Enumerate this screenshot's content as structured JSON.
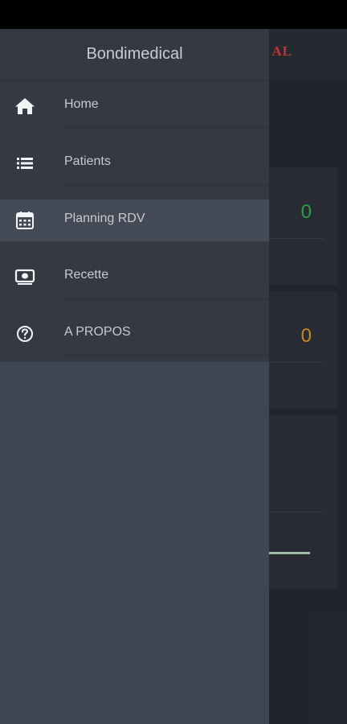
{
  "app": {
    "title_fragment": "AL",
    "stats": [
      {
        "value": "0",
        "color": "#2fb355"
      },
      {
        "value": "0",
        "color": "#e39b1f"
      }
    ]
  },
  "drawer": {
    "title": "Bondimedical",
    "items": [
      {
        "label": "Home",
        "icon": "home-icon"
      },
      {
        "label": "Patients",
        "icon": "list-icon"
      },
      {
        "label": "Planning RDV",
        "icon": "calendar-icon",
        "active": true
      },
      {
        "label": "Recette",
        "icon": "cash-icon"
      },
      {
        "label": "A PROPOS",
        "icon": "help-circle-icon"
      }
    ]
  },
  "colors": {
    "accent_red": "#e53935",
    "drawer_bg": "#343944",
    "active_item_bg": "#444a56"
  }
}
